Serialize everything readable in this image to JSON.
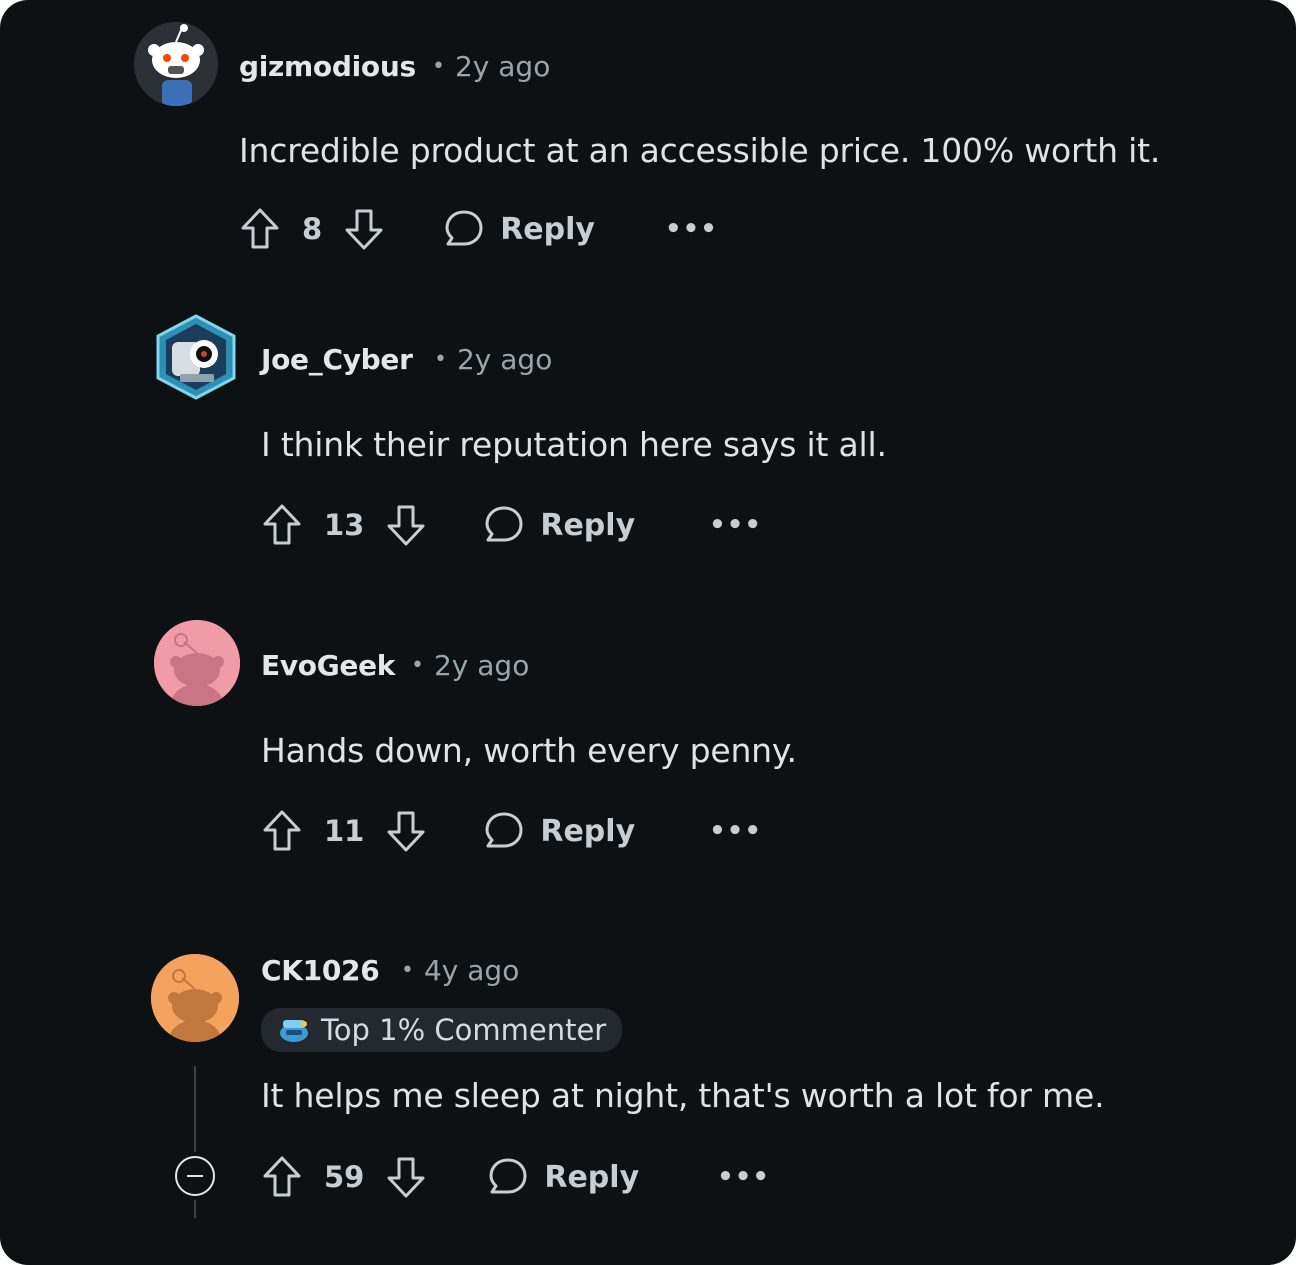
{
  "comments": [
    {
      "username": "gizmodious",
      "time": "2y ago",
      "body": "Incredible product at an accessible price. 100% worth it.",
      "votes": "8",
      "reply_label": "Reply",
      "more_label": "•••",
      "avatar_icon": "snoo-white-avatar"
    },
    {
      "username": "Joe_Cyber",
      "time": "2y ago",
      "body": "I think their reputation here says it all.",
      "votes": "13",
      "reply_label": "Reply",
      "more_label": "•••",
      "avatar_icon": "cyber-robot-avatar"
    },
    {
      "username": "EvoGeek",
      "time": "2y ago",
      "body": "Hands down, worth every penny.",
      "votes": "11",
      "reply_label": "Reply",
      "more_label": "•••",
      "avatar_icon": "snoo-pink-avatar"
    },
    {
      "username": "CK1026",
      "time": "4y ago",
      "badge": "Top 1% Commenter",
      "body": "It helps me sleep at night, that's worth a lot for me.",
      "votes": "59",
      "reply_label": "Reply",
      "more_label": "•••",
      "avatar_icon": "snoo-orange-avatar"
    }
  ],
  "colors": {
    "background": "#0e1113",
    "text_primary": "#e4e7ea",
    "text_secondary": "#9aa4ab",
    "badge_bg": "#23292e",
    "avatar_pink": "#f19ba7",
    "avatar_orange": "#f5a25f"
  }
}
